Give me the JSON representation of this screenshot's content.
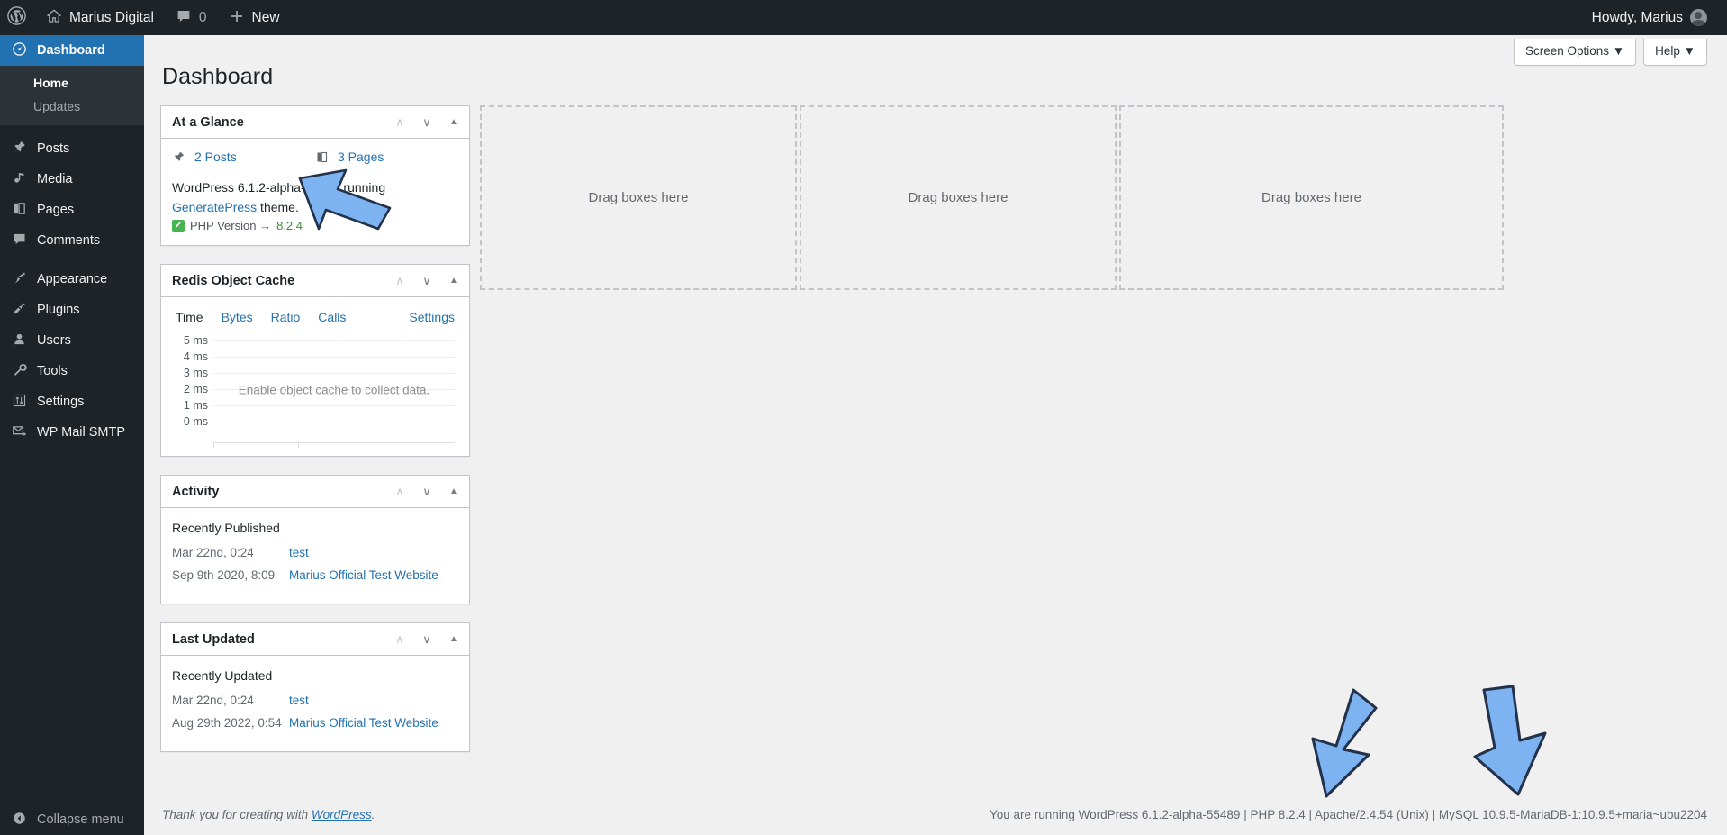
{
  "adminbar": {
    "wp_logo_icon": "wordpress-logo-icon",
    "site_name": "Marius Digital",
    "site_icon": "home-icon",
    "comments_icon": "comment-bubble-icon",
    "comments_count": "0",
    "new_icon": "plus-icon",
    "new_label": "New",
    "howdy": "Howdy, Marius",
    "avatar_icon": "user-avatar-icon"
  },
  "sidebar": {
    "items": [
      {
        "label": "Dashboard",
        "icon": "dashboard-gauge-icon",
        "glyph": "◔",
        "current": true
      },
      {
        "label": "Posts",
        "icon": "pin-icon",
        "glyph": "✒",
        "current": false
      },
      {
        "label": "Media",
        "icon": "media-icon",
        "glyph": "♫",
        "current": false
      },
      {
        "label": "Pages",
        "icon": "pages-icon",
        "glyph": "◧",
        "current": false
      },
      {
        "label": "Comments",
        "icon": "comment-bubble-icon",
        "glyph": "▢",
        "current": false
      },
      {
        "label": "Appearance",
        "icon": "paintbrush-icon",
        "glyph": "✎",
        "current": false
      },
      {
        "label": "Plugins",
        "icon": "plug-icon",
        "glyph": "⚡",
        "current": false
      },
      {
        "label": "Users",
        "icon": "user-icon",
        "glyph": "♟",
        "current": false
      },
      {
        "label": "Tools",
        "icon": "wrench-icon",
        "glyph": "⚒",
        "current": false
      },
      {
        "label": "Settings",
        "icon": "sliders-icon",
        "glyph": "⚙",
        "current": false
      },
      {
        "label": "WP Mail SMTP",
        "icon": "envelope-icon",
        "glyph": "✉",
        "current": false
      }
    ],
    "submenu": [
      {
        "label": "Home",
        "current": true
      },
      {
        "label": "Updates",
        "current": false
      }
    ],
    "collapse": {
      "label": "Collapse menu",
      "icon": "collapse-arrow-icon",
      "glyph": "◀"
    }
  },
  "screen_meta": {
    "screen_options": "Screen Options ▼",
    "help": "Help ▼"
  },
  "page": {
    "title": "Dashboard"
  },
  "widget_controls": {
    "move_up_icon": "chevron-up-icon",
    "move_down_icon": "chevron-down-icon",
    "toggle_icon": "triangle-up-toggle-icon",
    "move_up_glyph": "∧",
    "move_down_glyph": "∨",
    "toggle_glyph": "▲"
  },
  "at_a_glance": {
    "title": "At a Glance",
    "items": [
      {
        "icon": "pin-icon",
        "glyph": "✒",
        "label": "2 Posts"
      },
      {
        "icon": "pages-icon",
        "glyph": "◧",
        "label": "3 Pages"
      }
    ],
    "version_prefix": "WordPress 6.1.2-alpha-55489 running ",
    "theme_link": "GeneratePress",
    "version_suffix": " theme.",
    "php_check_icon": "green-check-icon",
    "php_check_glyph": "✔",
    "php_label": "PHP Version → ",
    "php_version": "8.2.4"
  },
  "redis": {
    "title": "Redis Object Cache",
    "tabs": [
      {
        "label": "Time",
        "active": true
      },
      {
        "label": "Bytes",
        "active": false
      },
      {
        "label": "Ratio",
        "active": false
      },
      {
        "label": "Calls",
        "active": false
      }
    ],
    "settings_label": "Settings",
    "empty_message": "Enable object cache to collect data."
  },
  "activity": {
    "title": "Activity",
    "subtitle": "Recently Published",
    "rows": [
      {
        "date": "Mar 22nd, 0:24",
        "link": "test"
      },
      {
        "date": "Sep 9th 2020, 8:09",
        "link": "Marius Official Test Website"
      }
    ]
  },
  "last_updated": {
    "title": "Last Updated",
    "subtitle": "Recently Updated",
    "rows": [
      {
        "date": "Mar 22nd, 0:24",
        "link": "test"
      },
      {
        "date": "Aug 29th 2022, 0:54",
        "link": "Marius Official Test Website"
      }
    ]
  },
  "dropzones": [
    {
      "label": "Drag boxes here"
    },
    {
      "label": "Drag boxes here"
    },
    {
      "label": "Drag boxes here"
    }
  ],
  "footer": {
    "thanks_prefix": "Thank you for creating with ",
    "thanks_link": "WordPress",
    "thanks_suffix": ".",
    "version_info": "You are running WordPress 6.1.2-alpha-55489 | PHP 8.2.4 | Apache/2.4.54 (Unix) | MySQL 10.9.5-MariaDB-1:10.9.5+maria~ubu2204"
  },
  "annotations": {
    "arrow_color": "#7EB3F2",
    "arrow_stroke": "#23314a",
    "arrows": [
      {
        "name": "arrow-pointing-php-version"
      },
      {
        "name": "arrow-pointing-footer-version-left"
      },
      {
        "name": "arrow-pointing-footer-version-right"
      }
    ]
  },
  "chart_data": {
    "type": "line",
    "title": "Redis Object Cache — Time",
    "xlabel": "",
    "ylabel": "",
    "categories": [],
    "series": [
      {
        "name": "Time",
        "values": []
      }
    ],
    "ytick_labels": [
      "5 ms",
      "4 ms",
      "3 ms",
      "2 ms",
      "1 ms",
      "0 ms"
    ],
    "yvalues": [
      5,
      4,
      3,
      2,
      1,
      0
    ],
    "ylim": [
      0,
      5
    ],
    "grid": true,
    "legend": "none",
    "empty_message": "Enable object cache to collect data."
  }
}
